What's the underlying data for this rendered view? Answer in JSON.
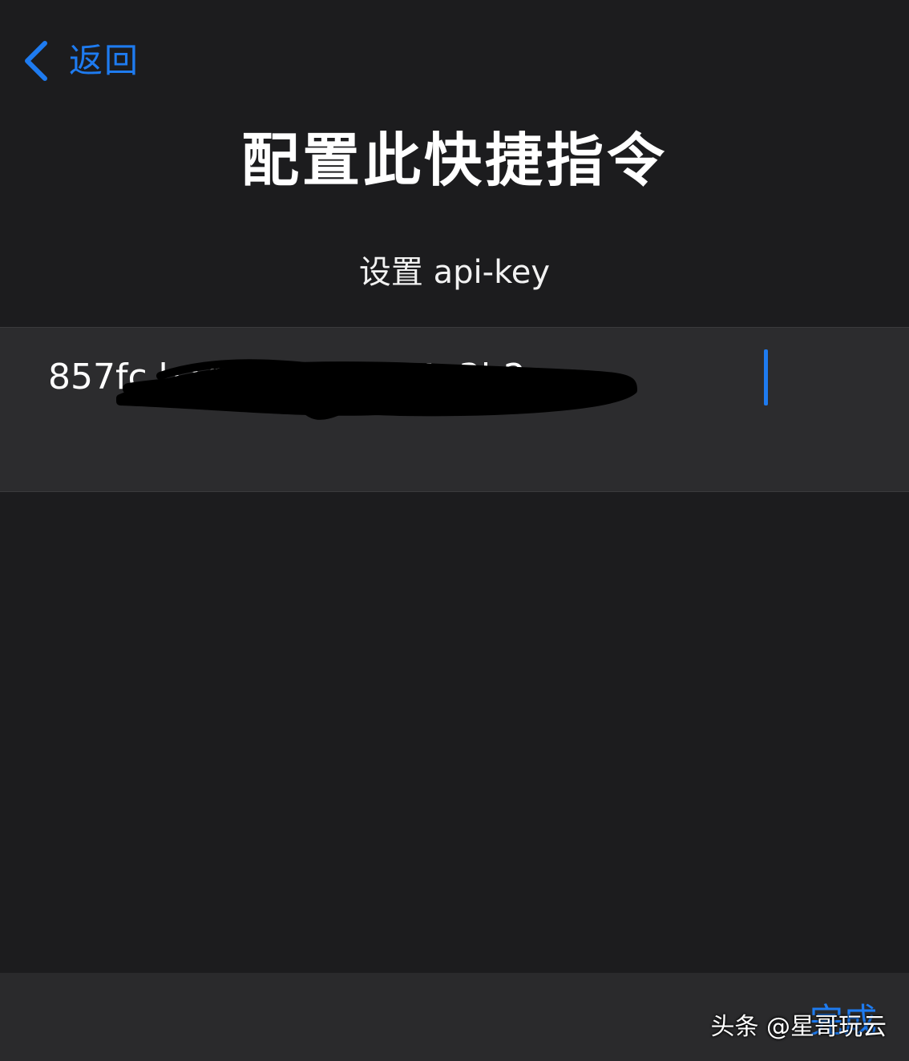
{
  "nav": {
    "back_label": "返回",
    "back_icon": "chevron-left-icon"
  },
  "page": {
    "title": "配置此快捷指令"
  },
  "field": {
    "label": "设置 api-key",
    "value": "857fc              ba4  6           5ea26fe4a3b2"
  },
  "footer": {
    "done_label": "完成",
    "watermark": "头条 @星哥玩云"
  },
  "colors": {
    "background": "#1c1c1e",
    "cell": "#2c2c2e",
    "accent": "#1e7bf0",
    "text": "#ffffff"
  }
}
